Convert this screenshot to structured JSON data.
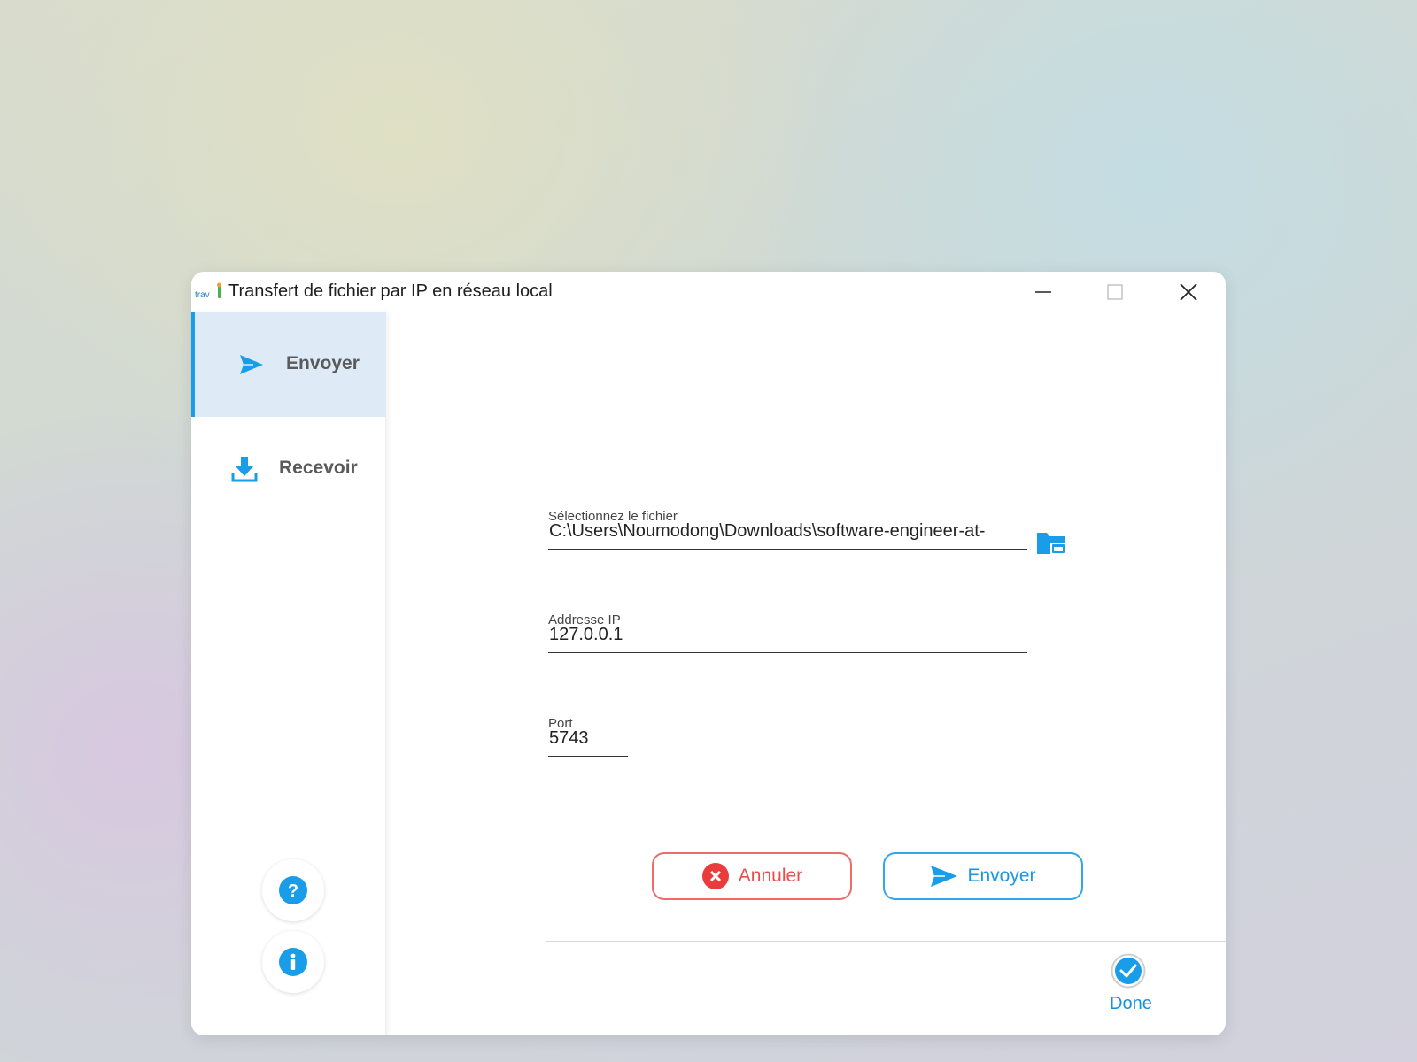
{
  "window": {
    "title": "Transfert de fichier par IP en réseau local",
    "app_icon": "trav-app-icon"
  },
  "sidebar": {
    "items": [
      {
        "label": "Envoyer",
        "icon": "send-icon",
        "active": true
      },
      {
        "label": "Recevoir",
        "icon": "download-icon",
        "active": false
      }
    ],
    "help_icon": "help-icon",
    "info_icon": "info-icon"
  },
  "form": {
    "file_label": "Sélectionnez le fichier",
    "file_value": "C:\\Users\\Noumodong\\Downloads\\software-engineer-at-",
    "ip_label": "Addresse IP",
    "ip_value": "127.0.0.1",
    "port_label": "Port",
    "port_value": "5743"
  },
  "buttons": {
    "cancel_label": "Annuler",
    "send_label": "Envoyer"
  },
  "status": {
    "label": "Done",
    "icon": "check-icon"
  },
  "colors": {
    "accent": "#1a9de8",
    "cancel": "#ea4c4c",
    "active_bg": "#deebf6"
  }
}
